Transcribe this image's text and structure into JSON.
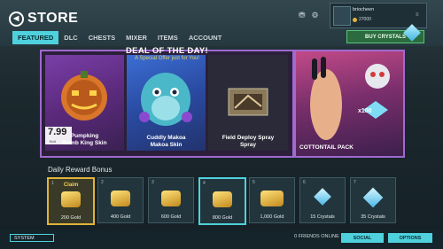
{
  "header": {
    "title": "STORE",
    "tabs": [
      {
        "label": "FEATURED",
        "active": true
      },
      {
        "label": "DLC"
      },
      {
        "label": "CHESTS"
      },
      {
        "label": "MIXER"
      },
      {
        "label": "ITEMS"
      },
      {
        "label": "ACCOUNT"
      }
    ]
  },
  "profile": {
    "username": "briocheen",
    "currency": "27000"
  },
  "buy_crystals": {
    "label": "BUY CRYSTALS"
  },
  "deal": {
    "title": "DEAL OF THE DAY!",
    "subtitle": "A Special Offer just for You!",
    "price": "7.99",
    "price_note": "Bolt",
    "items": [
      {
        "name": "Pumpking\nBomb King Skin"
      },
      {
        "name": "Cuddly Makoa\nMakoa Skin"
      },
      {
        "name": "Field Deploy Spray\nSpray"
      }
    ]
  },
  "cottontail": {
    "label": "COTTONTAIL PACK",
    "count": "x100"
  },
  "daily": {
    "title": "Daily Reward Bonus",
    "claim": "Claim",
    "rewards": [
      {
        "label": "200 Gold",
        "type": "gold"
      },
      {
        "label": "400 Gold",
        "type": "gold"
      },
      {
        "label": "600 Gold",
        "type": "gold"
      },
      {
        "label": "800 Gold",
        "type": "gold"
      },
      {
        "label": "1,000 Gold",
        "type": "gold"
      },
      {
        "label": "15 Crystals",
        "type": "crystal"
      },
      {
        "label": "35 Crystals",
        "type": "crystal"
      }
    ]
  },
  "footer": {
    "system": "SYSTEM",
    "friends_online": "0 FRIENDS ONLINE",
    "social": "SOCIAL",
    "options": "OPTIONS"
  },
  "colors": {
    "accent": "#4fd1dd",
    "deal_border": "#a06ad0",
    "gold": "#e0b43a"
  }
}
